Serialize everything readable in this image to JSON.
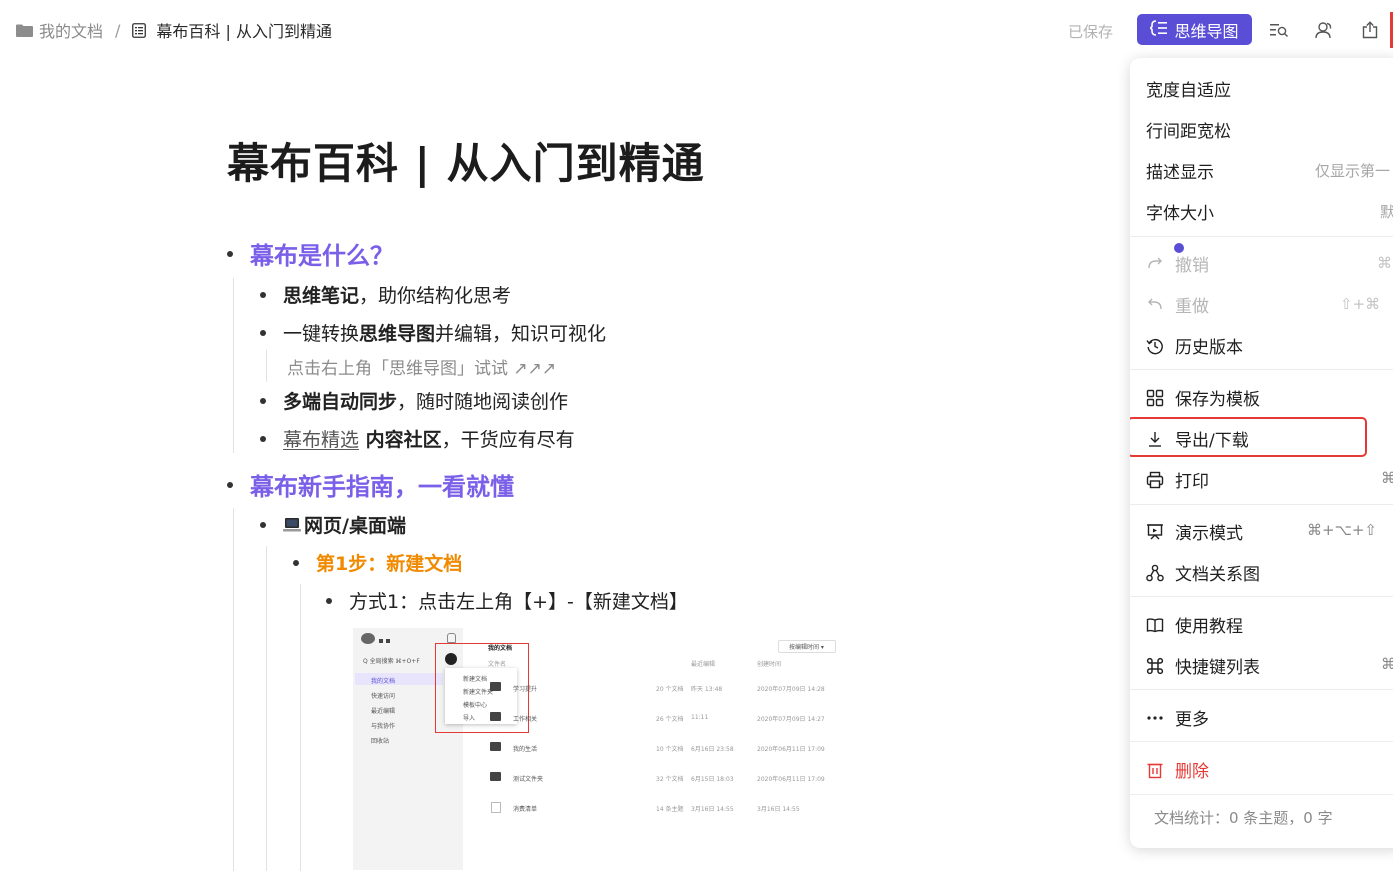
{
  "breadcrumb": {
    "root": "我的文档",
    "separator": "/",
    "doc": "幕布百科 | 从入门到精通"
  },
  "header": {
    "saved": "已保存",
    "mindmap_button": "思维导图",
    "mindmap_glyph": "⪡☰"
  },
  "doc": {
    "title": "幕布百科 | 从入门到精通",
    "s1": {
      "heading": "幕布是什么？"
    },
    "i1": {
      "bold": "思维笔记",
      "rest": "，助你结构化思考"
    },
    "i2": {
      "pre": "一键转换",
      "bold": "思维导图",
      "rest": "并编辑，知识可视化"
    },
    "i2_note": "点击右上角「思维导图」试试 ↗↗↗",
    "i3": {
      "bold": "多端自动同步",
      "rest": "，随时随地阅读创作"
    },
    "i4": {
      "link": "幕布精选",
      "bold": " 内容社区",
      "rest": "，干货应有尽有"
    },
    "s2": {
      "heading": "幕布新手指南，一看就懂"
    },
    "i5": {
      "label": "网页/桌面端"
    },
    "i6": {
      "label": "第1步：新建文档"
    },
    "i7": {
      "label": "方式1：点击左上角【+】-【新建文档】"
    },
    "shot": {
      "search": "Q 全局搜索 ⌘+O+F",
      "side_items": [
        "我的文档",
        "快速访问",
        "最近编辑",
        "与我协作",
        "回收站"
      ],
      "popup_items": [
        "新建文档",
        "新建文件夹",
        "模板中心",
        "导入"
      ],
      "head": "我的文档",
      "sort": "按编辑时间 ▾",
      "cols": [
        "文件名",
        "最近编辑",
        "创建时间"
      ],
      "rows": [
        {
          "name": "学习提升",
          "count": "20 个文档",
          "edit": "昨天 13:48",
          "created": "2020年07月09日 14:28"
        },
        {
          "name": "工作相关",
          "count": "26 个文档",
          "edit": "11:11",
          "created": "2020年07月09日 14:27"
        },
        {
          "name": "我的生活",
          "count": "10 个文档",
          "edit": "6月16日 23:58",
          "created": "2020年06月11日 17:09"
        },
        {
          "name": "测试文件夹",
          "count": "32 个文档",
          "edit": "6月15日 18:03",
          "created": "2020年06月11日 17:09"
        },
        {
          "name": "消费清单",
          "count": "14 条主题",
          "edit": "3月16日 14:55",
          "created": "3月16日 14:55"
        }
      ]
    }
  },
  "menu": {
    "width_fit": {
      "label": "宽度自适应"
    },
    "line_loose": {
      "label": "行间距宽松"
    },
    "desc_show": {
      "label": "描述显示",
      "value": "仅显示第一"
    },
    "font_size": {
      "label": "字体大小",
      "value": "默"
    },
    "undo": {
      "label": "撤销",
      "value": "⌘"
    },
    "redo": {
      "label": "重做",
      "value": "⇧+⌘"
    },
    "history": {
      "label": "历史版本"
    },
    "save_template": {
      "label": "保存为模板"
    },
    "export": {
      "label": "导出/下载"
    },
    "print": {
      "label": "打印",
      "value": "⌘"
    },
    "present": {
      "label": "演示模式",
      "value": "⌘+⌥+⇧"
    },
    "relation": {
      "label": "文档关系图"
    },
    "tutorial": {
      "label": "使用教程"
    },
    "shortcuts": {
      "label": "快捷键列表",
      "value": "⌘"
    },
    "more": {
      "label": "更多"
    },
    "delete": {
      "label": "删除"
    },
    "stats": "文档统计：0 条主题，0 字"
  },
  "colors": {
    "accent": "#5b4ed6",
    "heading_purple": "#7a5fe8",
    "step_orange": "#f08a00",
    "danger": "#e53935"
  }
}
